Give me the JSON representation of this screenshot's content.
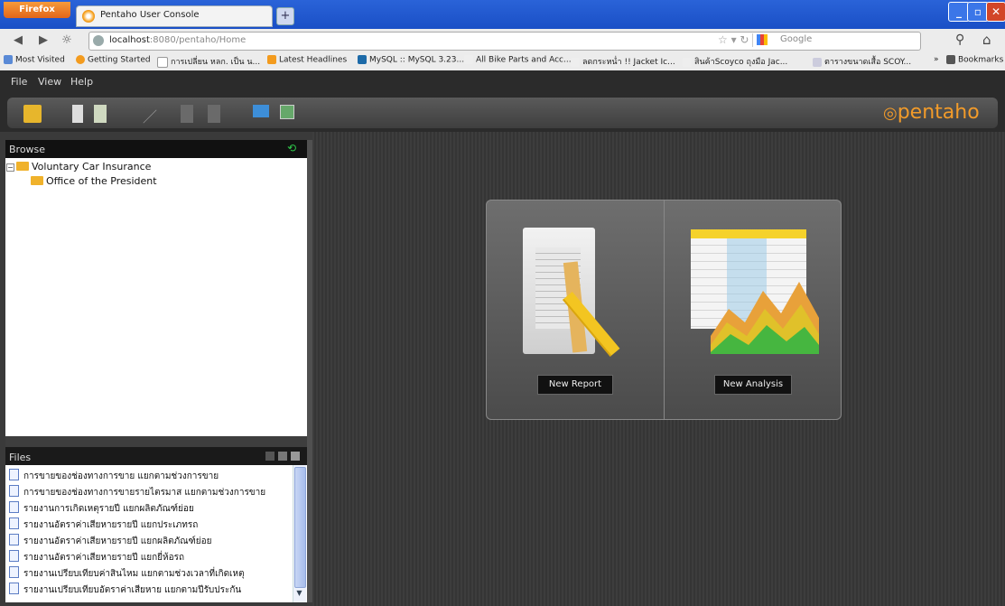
{
  "browser": {
    "app_button": "Firefox",
    "tab_title": "Pentaho User Console",
    "url_host": "localhost",
    "url_rest": ":8080/pentaho/Home",
    "search_engine": "Google"
  },
  "bookmarks": {
    "items": [
      "Most Visited",
      "Getting Started",
      "การเปลี่ยน หลก. เป็น น...",
      "Latest Headlines",
      "MySQL :: MySQL 3.23...",
      "All Bike Parts and Acc...",
      "ลดกระหน่ำ !! Jacket Ic...",
      "สินค้าScoyco ถุงมือ Jac...",
      "ตารางขนาดเสื้อ SCOY..."
    ],
    "overflow": "»",
    "bookmarks_label": "Bookmarks"
  },
  "pentaho": {
    "menu": [
      "File",
      "View",
      "Help"
    ],
    "logo": "pentaho",
    "browse_title": "Browse",
    "tree": {
      "root": "Voluntary Car Insurance",
      "child": "Office of the President"
    },
    "files_title": "Files",
    "files": [
      "การขายของช่องทางการขาย แยกตามช่วงการขาย",
      "การขายของช่องทางการขายรายไตรมาส แยกตามช่วงการขาย",
      "รายงานการเกิดเหตุรายปี แยกผลิตภัณฑ์ย่อย",
      "รายงานอัตราค่าเสียหายรายปี แยกประเภทรถ",
      "รายงานอัตราค่าเสียหายรายปี แยกผลิตภัณฑ์ย่อย",
      "รายงานอัตราค่าเสียหายรายปี แยกยี่ห้อรถ",
      "รายงานเปรียบเทียบค่าสินไหม แยกตามช่วงเวลาที่เกิดเหตุ",
      "รายงานเปรียบเทียบอัตราค่าเสียหาย แยกตามปีรับประกัน"
    ],
    "new_report": "New Report",
    "new_analysis": "New Analysis"
  },
  "colors": {
    "logo": "#f29b2a",
    "titlebar": "#2a63d8",
    "refresh": "#2ec64a"
  }
}
